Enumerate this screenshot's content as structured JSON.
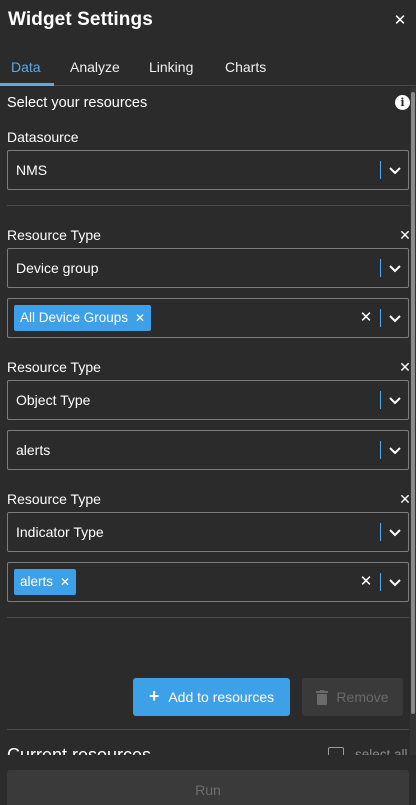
{
  "header": {
    "title": "Widget Settings",
    "close_icon": "close-icon"
  },
  "tabs": [
    {
      "label": "Data",
      "active": true
    },
    {
      "label": "Analyze",
      "active": false
    },
    {
      "label": "Linking",
      "active": false
    },
    {
      "label": "Charts",
      "active": false
    }
  ],
  "data_tab": {
    "select_resources_label": "Select your resources",
    "info_icon": "info-icon",
    "datasource": {
      "label": "Datasource",
      "value": "NMS"
    },
    "resource_type_label": "Resource Type",
    "groups": [
      {
        "type_value": "Device group",
        "second_kind": "chips",
        "chips": [
          "All Device Groups"
        ]
      },
      {
        "type_value": "Object Type",
        "second_kind": "select",
        "second_value": "alerts"
      },
      {
        "type_value": "Indicator Type",
        "second_kind": "chips",
        "chips": [
          "alerts"
        ]
      }
    ],
    "add_button_label": "Add to resources",
    "remove_button_label": "Remove",
    "current_resources_label": "Current resources",
    "select_all_label": "select all",
    "run_button_label": "Run"
  },
  "colors": {
    "accent": "#3ea0e6",
    "background": "#2b2b2b",
    "border": "#7c7c7c",
    "disabled": "#3a3a3a"
  }
}
